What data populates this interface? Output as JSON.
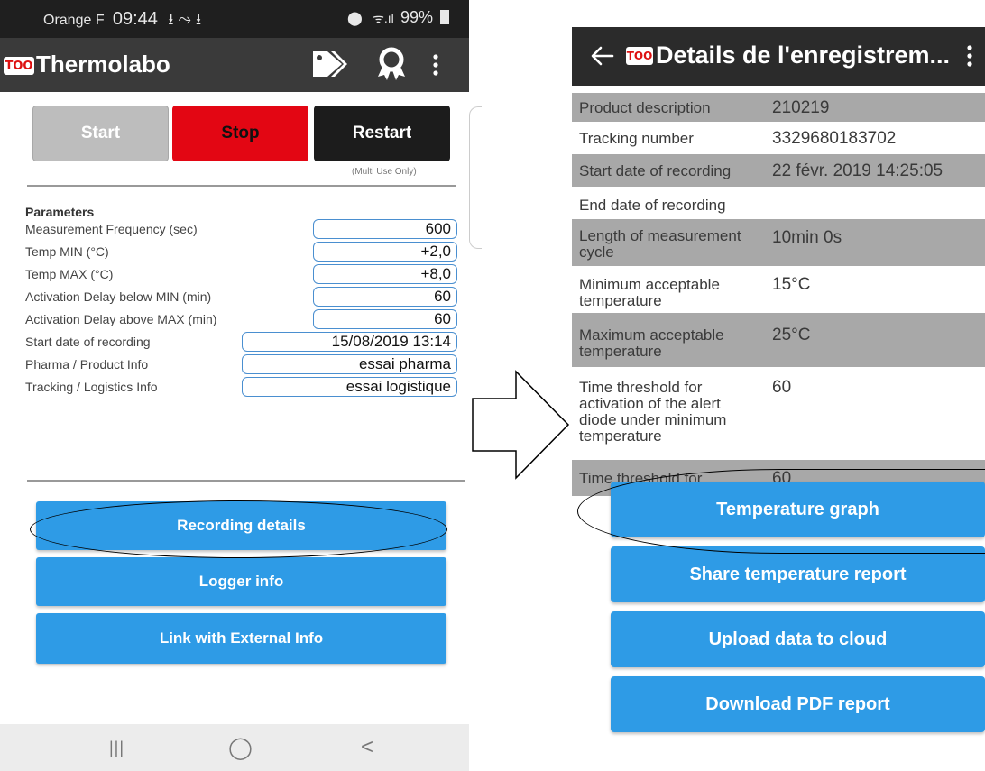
{
  "left_screen": {
    "status_bar": {
      "carrier": "Orange F",
      "time": "09:44",
      "left_icons": "⭳ ⤳ ⭳",
      "battery": "99%"
    },
    "app_bar": {
      "logo_text": "TOO",
      "title": "Thermolabo"
    },
    "controls": {
      "start_label": "Start",
      "stop_label": "Stop",
      "restart_label": "Restart",
      "restart_note": "(Multi Use Only)"
    },
    "parameters": {
      "title": "Parameters",
      "items": [
        {
          "label": "Measurement Frequency (sec)",
          "value": "600"
        },
        {
          "label": "Temp MIN (°C)",
          "value": "+2,0"
        },
        {
          "label": "Temp MAX (°C)",
          "value": "+8,0"
        },
        {
          "label": "Activation Delay below MIN (min)",
          "value": "60"
        },
        {
          "label": "Activation Delay above MAX (min)",
          "value": "60"
        },
        {
          "label": "Start date of recording",
          "value": "15/08/2019 13:14"
        },
        {
          "label": "Pharma / Product Info",
          "value": "essai pharma"
        },
        {
          "label": "Tracking / Logistics Info",
          "value": "essai logistique"
        }
      ]
    },
    "actions": {
      "recording_details": "Recording details",
      "logger_info": "Logger info",
      "link_external": "Link with External Info"
    },
    "nav": {
      "recents": "|||",
      "home": "◯",
      "back": "<"
    }
  },
  "right_screen": {
    "app_bar": {
      "logo_text": "TOO",
      "title": "Details de l'enregistrem..."
    },
    "details": [
      {
        "label": "Product description",
        "value": "210219"
      },
      {
        "label": "Tracking number",
        "value": "3329680183702"
      },
      {
        "label": "Start date of recording",
        "value": "22 févr. 2019 14:25:05"
      },
      {
        "label": "End date of recording",
        "value": ""
      },
      {
        "label": "Length of measurement cycle",
        "value": "10min 0s"
      },
      {
        "label": "Minimum acceptable temperature",
        "value": "15°C"
      },
      {
        "label": "Maximum acceptable temperature",
        "value": "25°C"
      },
      {
        "label": "Time threshold for activation of the alert diode under minimum temperature",
        "value": "60"
      },
      {
        "label": "Time threshold for",
        "value": "60"
      }
    ],
    "actions": {
      "temperature_graph": "Temperature graph",
      "share_report": "Share temperature report",
      "upload_cloud": "Upload data to cloud",
      "download_pdf": "Download PDF report"
    }
  },
  "colors": {
    "stop_red": "#e30613",
    "restart_black": "#1c1c1c",
    "start_gray": "#bdbdbd",
    "action_blue": "#2e9be6",
    "input_border": "#4a8fd0",
    "row_gray": "#a8a8a8"
  }
}
